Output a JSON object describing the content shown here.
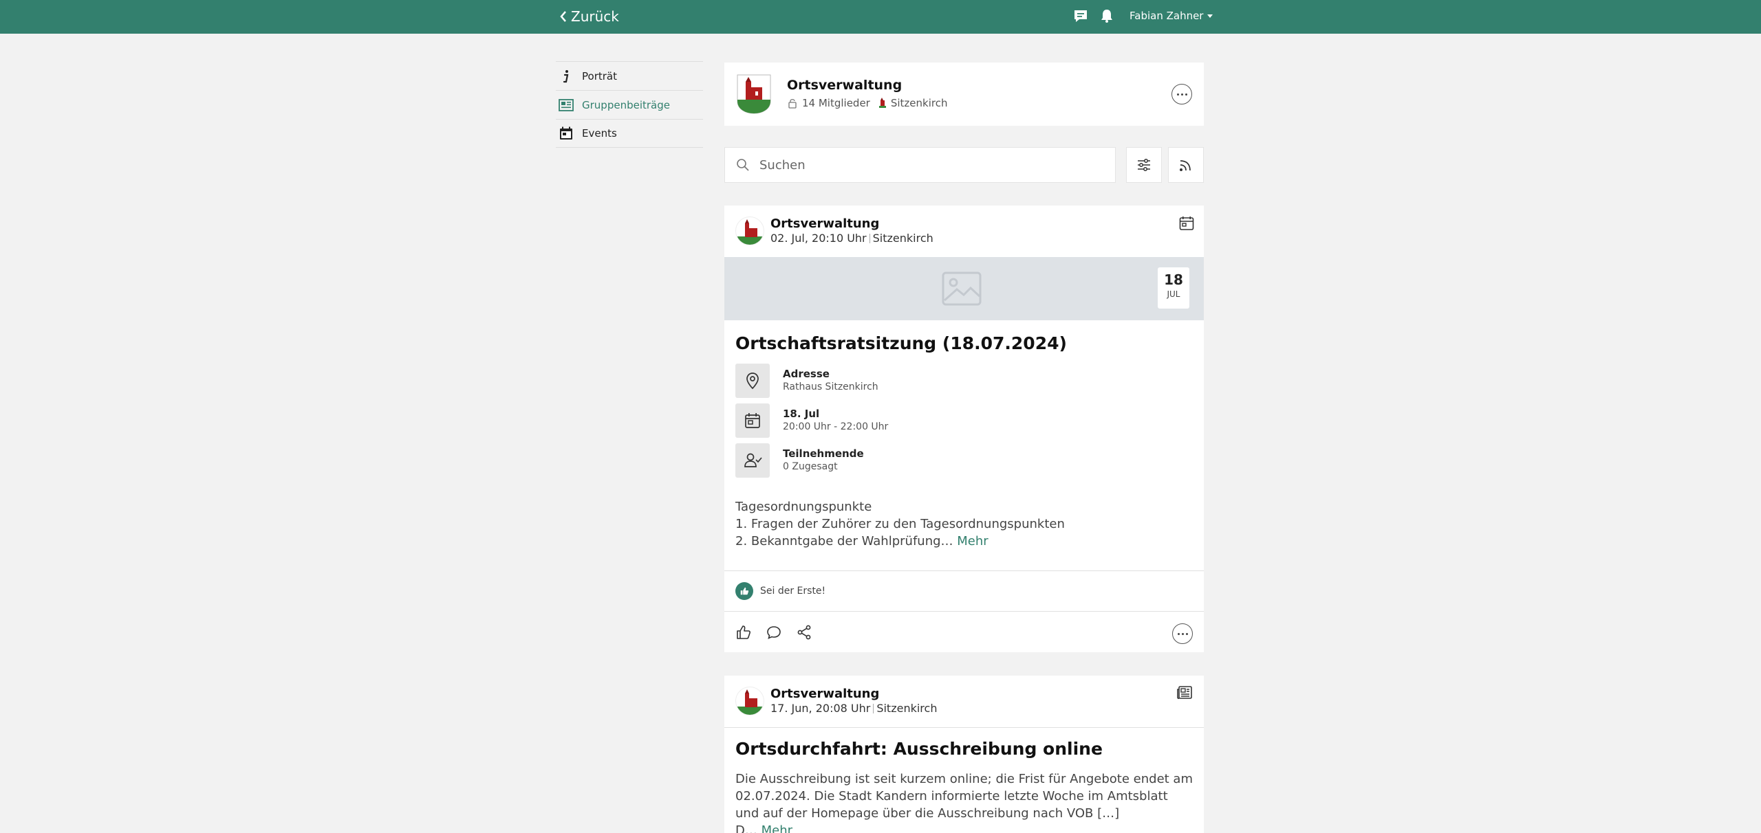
{
  "topbar": {
    "back_label": "Zurück",
    "user_name": "Fabian Zahner",
    "color": "#33806e"
  },
  "sidebar": {
    "items": [
      {
        "label": "Porträt",
        "icon": "info-icon"
      },
      {
        "label": "Gruppenbeiträge",
        "icon": "newspaper-icon",
        "active": true
      },
      {
        "label": "Events",
        "icon": "calendar-icon"
      }
    ]
  },
  "group": {
    "name": "Ortsverwaltung",
    "members": "14 Mitglieder",
    "location": "Sitzenkirch"
  },
  "search": {
    "placeholder": "Suchen"
  },
  "posts": [
    {
      "author": "Ortsverwaltung",
      "time": "02. Jul, 20:10 Uhr",
      "location": "Sitzenkirch",
      "type_icon": "calendar-icon",
      "date_day": "18",
      "date_month": "JUL",
      "title": "Ortschaftsratsitzung (18.07.2024)",
      "info": [
        {
          "label": "Adresse",
          "value": "Rathaus Sitzenkirch",
          "icon": "location-pin-icon"
        },
        {
          "label": "18. Jul",
          "value": "20:00 Uhr - 22:00 Uhr",
          "icon": "calendar-icon"
        },
        {
          "label": "Teilnehmende",
          "value": "0 Zugesagt",
          "icon": "user-check-icon"
        }
      ],
      "desc_lines": [
        "Tagesordnungspunkte",
        "1. Fragen der Zuhörer zu den Tagesordnungspunkten",
        "2. Bekanntgabe der Wahlprüfung… "
      ],
      "more_label": "Mehr",
      "reaction_text": "Sei der Erste!"
    },
    {
      "author": "Ortsverwaltung",
      "time": "17. Jun, 20:08 Uhr",
      "location": "Sitzenkirch",
      "type_icon": "newspaper-icon",
      "title": "Ortsdurchfahrt: Ausschreibung online",
      "text": "Die Ausschreibung ist seit kurzem online; die Frist für Angebote endet am 02.07.2024. Die Stadt Kandern informierte letzte Woche im Amtsblatt und auf der Homepage über die Ausschreibung nach VOB […]",
      "text_tail": "D… ",
      "more_label": "Mehr"
    }
  ]
}
